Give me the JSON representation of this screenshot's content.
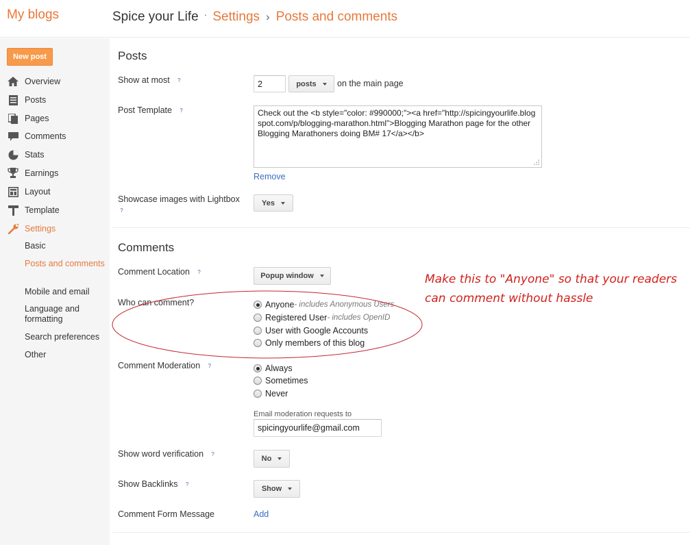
{
  "header": {
    "my_blogs": "My blogs",
    "blog_name": "Spice your Life",
    "sep_dot": "·",
    "crumb_sep": "›",
    "crumb_settings": "Settings",
    "crumb_page": "Posts and comments"
  },
  "sidebar": {
    "new_post": "New post",
    "items": [
      {
        "label": "Overview",
        "icon": "home-icon"
      },
      {
        "label": "Posts",
        "icon": "posts-icon"
      },
      {
        "label": "Pages",
        "icon": "pages-icon"
      },
      {
        "label": "Comments",
        "icon": "comments-icon"
      },
      {
        "label": "Stats",
        "icon": "stats-icon"
      },
      {
        "label": "Earnings",
        "icon": "trophy-icon"
      },
      {
        "label": "Layout",
        "icon": "layout-icon"
      },
      {
        "label": "Template",
        "icon": "template-icon"
      },
      {
        "label": "Settings",
        "icon": "wrench-icon"
      }
    ],
    "sub_items": [
      "Basic",
      "Posts and comments",
      "Mobile and email",
      "Language and formatting",
      "Search preferences",
      "Other"
    ]
  },
  "posts": {
    "title": "Posts",
    "show_at_most_label": "Show at most",
    "show_at_most_value": "2",
    "posts_unit": "posts",
    "on_main_page": "on the main page",
    "post_template_label": "Post Template",
    "post_template_value": "Check out the <b style=\"color: #990000;\"><a href=\"http://spicingyourlife.blogspot.com/p/blogging-marathon.html\">Blogging Marathon page for the other Blogging Marathoners doing BM# 17</a></b>",
    "remove": "Remove",
    "lightbox_label": "Showcase images with Lightbox",
    "lightbox_value": "Yes"
  },
  "comments": {
    "title": "Comments",
    "location_label": "Comment Location",
    "location_value": "Popup window",
    "who_label": "Who can comment?",
    "who_options": [
      {
        "label": "Anyone",
        "hint": " - includes Anonymous Users"
      },
      {
        "label": "Registered User",
        "hint": " - includes OpenID"
      },
      {
        "label": "User with Google Accounts",
        "hint": ""
      },
      {
        "label": "Only members of this blog",
        "hint": ""
      }
    ],
    "moderation_label": "Comment Moderation",
    "moderation_options": [
      "Always",
      "Sometimes",
      "Never"
    ],
    "email_moderation_label": "Email moderation requests to",
    "email_value": "spicingyourlife@gmail.com",
    "word_verification_label": "Show word verification",
    "word_verification_value": "No",
    "backlinks_label": "Show Backlinks",
    "backlinks_value": "Show",
    "form_message_label": "Comment Form Message",
    "form_message_link": "Add"
  },
  "annotation": {
    "line1": "Make this to \"Anyone\" so that your readers",
    "line2": "can comment without hassle"
  },
  "help_glyph": "?",
  "colors": {
    "accent": "#e6793c",
    "link": "#3c6ac4",
    "annotation": "#d0211c"
  }
}
